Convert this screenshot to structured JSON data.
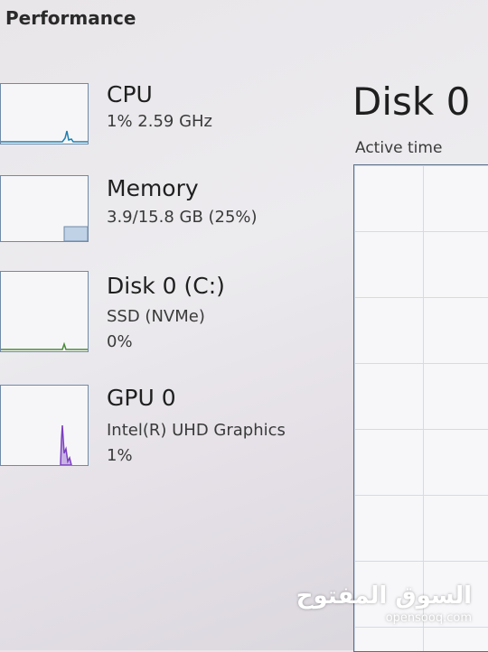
{
  "header": {
    "title": "Performance"
  },
  "items": {
    "cpu": {
      "name": "CPU",
      "detail": "1%  2.59 GHz",
      "color": "#1e7fb0",
      "level": 0.01
    },
    "memory": {
      "name": "Memory",
      "detail": "3.9/15.8 GB (25%)",
      "color": "#7a9ac0",
      "level": 0.25
    },
    "disk": {
      "name": "Disk 0 (C:)",
      "type": "SSD (NVMe)",
      "usage": "0%",
      "color": "#4a8a3a",
      "level": 0.0
    },
    "gpu": {
      "name": "GPU 0",
      "model": "Intel(R) UHD Graphics",
      "usage": "1%",
      "color": "#7b3fbf",
      "level": 0.01
    }
  },
  "detail": {
    "title": "Disk 0",
    "graph_label": "Active time"
  },
  "watermark": {
    "arabic": "السوق المفتوح",
    "latin": "opensooq.com"
  }
}
